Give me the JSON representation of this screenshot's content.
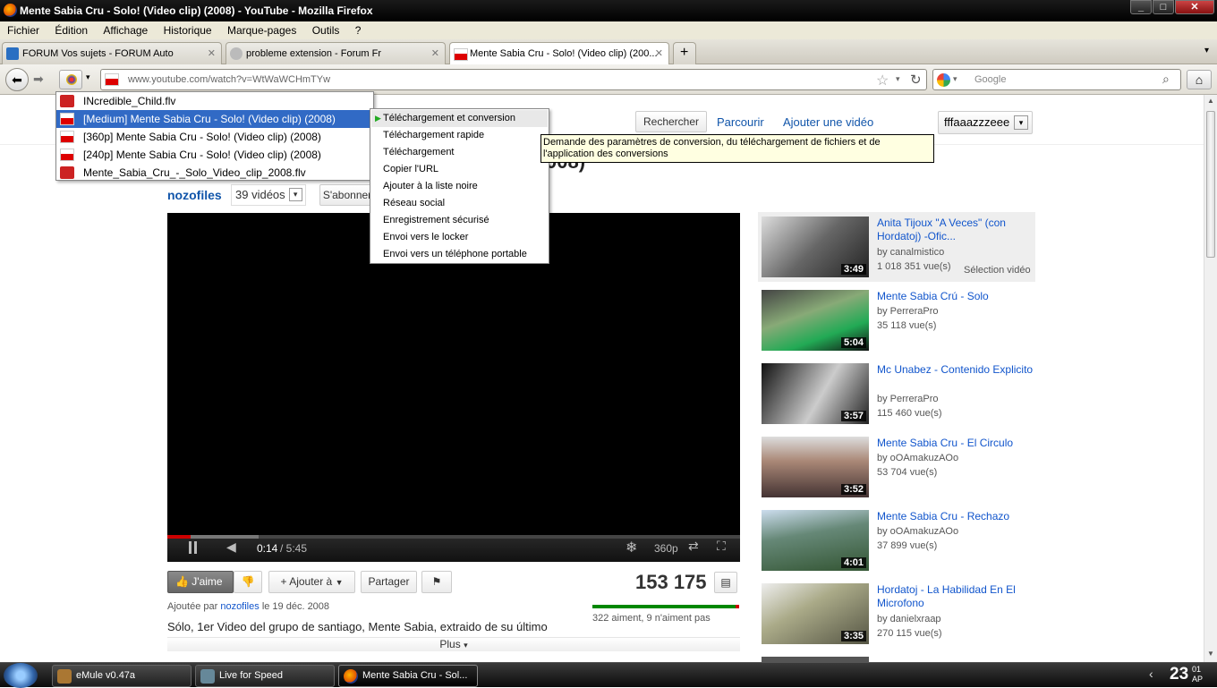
{
  "window": {
    "title": "Mente Sabia Cru - Solo! (Video clip) (2008) - YouTube - Mozilla Firefox"
  },
  "menu": [
    "Fichier",
    "Édition",
    "Affichage",
    "Historique",
    "Marque-pages",
    "Outils",
    "?"
  ],
  "tabs": [
    {
      "label": "FORUM Vos sujets - FORUM Auto"
    },
    {
      "label": "probleme extension - Forum Fr"
    },
    {
      "label": "Mente Sabia Cru - Solo! (Video clip) (200..."
    }
  ],
  "nav": {
    "url": "www.youtube.com/watch?v=WtWaWCHmTYw",
    "search_placeholder": "Google"
  },
  "youtube": {
    "search_button": "Rechercher",
    "browse": "Parcourir",
    "upload": "Ajouter une vidéo",
    "user": "fffaaazzzeee",
    "title_fragment": "008)",
    "channel": "nozofiles",
    "video_count": "39 vidéos",
    "subscribe": "S'abonner",
    "time_current": "0:14",
    "time_total": "/ 5:45",
    "quality": "360p",
    "like": "J'aime",
    "add_to": "Ajouter à",
    "share": "Partager",
    "views": "153 175",
    "ratings_text": "322 aiment, 9 n'aiment pas",
    "added_by_prefix": "Ajoutée par",
    "added_by_user": "nozofiles",
    "added_date": "le 19 déc. 2008",
    "description": "Sólo, 1er Video del grupo de santiago, Mente Sabia, extraido de su último",
    "more": "Plus"
  },
  "related": [
    {
      "title": "Anita Tijoux \"A Veces\" (con Hordatoj) -Ofic...",
      "by": "by canalmistico",
      "views": "1 018 351 vue(s)",
      "duration": "3:49",
      "extra": "Sélection vidéo"
    },
    {
      "title": "Mente Sabia Crú - Solo",
      "by": "by PerreraPro",
      "views": "35 118 vue(s)",
      "duration": "5:04"
    },
    {
      "title": "Mc Unabez - Contenido Explicito",
      "by": "by PerreraPro",
      "views": "115 460 vue(s)",
      "duration": "3:57"
    },
    {
      "title": "Mente Sabia Cru - El Circulo",
      "by": "by oOAmakuzAOo",
      "views": "53 704 vue(s)",
      "duration": "3:52"
    },
    {
      "title": "Mente Sabia Cru - Rechazo",
      "by": "by oOAmakuzAOo",
      "views": "37 899 vue(s)",
      "duration": "4:01"
    },
    {
      "title": "Hordatoj - La Habilidad En El Microfono",
      "by": "by danielxraap",
      "views": "270 115 vue(s)",
      "duration": "3:35"
    }
  ],
  "dropdown": [
    {
      "label": "INcredible_Child.flv",
      "icon": "flv-file-icon"
    },
    {
      "label": "[Medium] Mente Sabia Cru - Solo! (Video clip) (2008)",
      "icon": "youtube-icon"
    },
    {
      "label": "[360p] Mente Sabia Cru - Solo! (Video clip) (2008)",
      "icon": "youtube-icon"
    },
    {
      "label": "[240p] Mente Sabia Cru - Solo! (Video clip) (2008)",
      "icon": "youtube-icon"
    },
    {
      "label": "Mente_Sabia_Cru_-_Solo_Video_clip_2008.flv",
      "icon": "flv-file-icon"
    }
  ],
  "submenu": [
    "Téléchargement et conversion",
    "Téléchargement rapide",
    "Téléchargement",
    "Copier l'URL",
    "Ajouter à la liste noire",
    "Réseau social",
    "Enregistrement sécurisé",
    "Envoi vers le locker",
    "Envoi vers un téléphone portable"
  ],
  "tooltip": "Demande des paramètres de conversion, du téléchargement de fichiers et de l'application des conversions",
  "taskbar": {
    "tasks": [
      "eMule v0.47a",
      "Live for Speed",
      "Mente Sabia Cru - Sol..."
    ],
    "clock_hour": "23",
    "clock_min": "01",
    "clock_suffix": "AP"
  },
  "colors": {
    "accent": "#316ac5",
    "link": "#1155cc",
    "like_green": "#3a9a3a"
  }
}
